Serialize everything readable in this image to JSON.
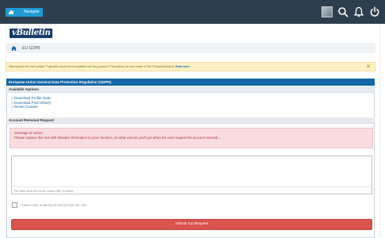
{
  "header": {
    "navigate_label": "Navigate"
  },
  "logo": {
    "text": "vBulletin"
  },
  "breadcrumb": {
    "current": "EU GDPR"
  },
  "warning": {
    "text": "Warning from the next update, ProjectAM should be incompatible with any product of ThreadAuto the new owner of TAZ (ThreadAutoSave)",
    "link": "Read more...",
    "close": "✕"
  },
  "section": {
    "title": "European Union General Data Protection Regulation (GDPR)",
    "available_options": "Available Options",
    "options": [
      "» Download Profile Data",
      "» Download Post History",
      "» Reset Cookies"
    ],
    "removal_title": "Account Removal Request"
  },
  "admin_message": {
    "line1": "Message to Admin:",
    "line2": "Please replace this text with detailed information to your member, on what actions you'll get when the user request his account removal...."
  },
  "form": {
    "hint": "Fill: Write some text for the reason (Min 25 chars).",
    "checkbox_label": "I have read, understood and accept the risk.",
    "submit_label": "Submit my Request"
  },
  "colors": {
    "topbar": "#2d3e4f",
    "accent": "#1566a6",
    "danger": "#d9534f",
    "warning_bg": "#fdf2c4"
  }
}
